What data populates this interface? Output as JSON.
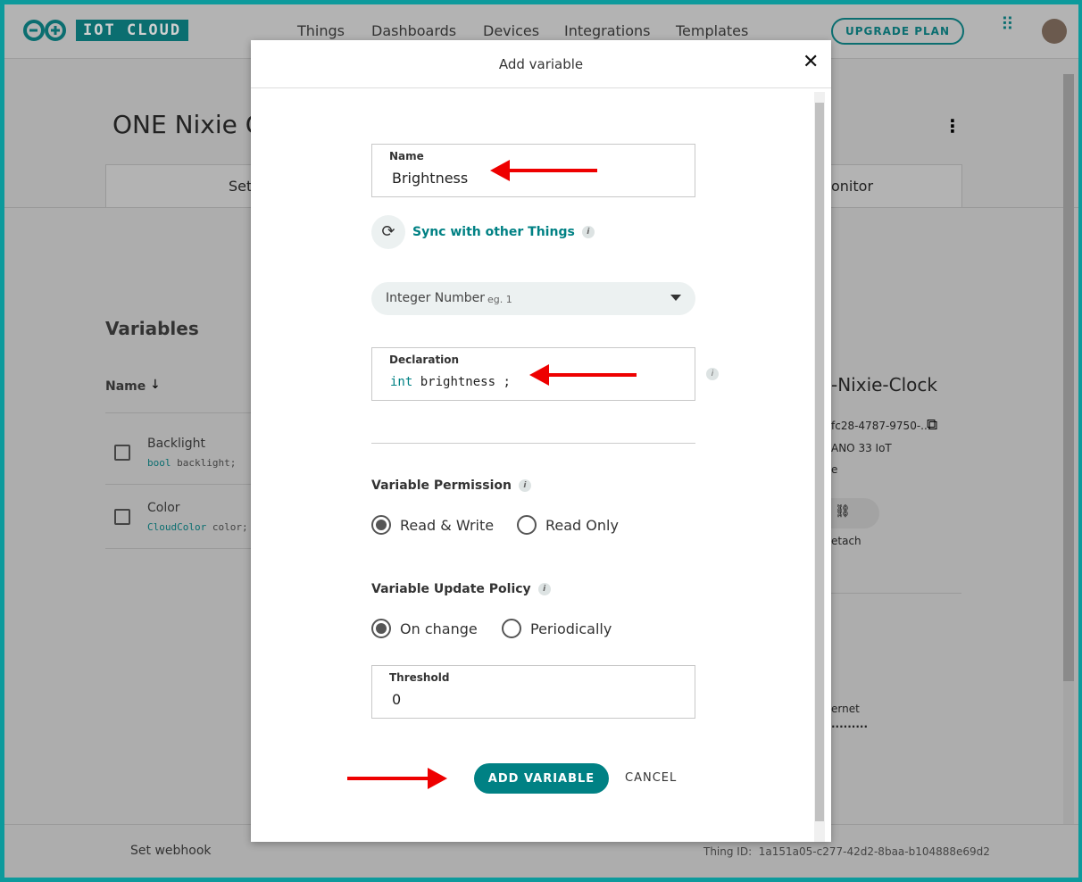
{
  "header": {
    "logo_text": "IOT CLOUD",
    "nav": [
      "Things",
      "Dashboards",
      "Devices",
      "Integrations",
      "Templates"
    ],
    "upgrade": "UPGRADE PLAN"
  },
  "background": {
    "thing_title": "ONE Nixie C",
    "tab_setup": "Set",
    "tab_monitor": "onitor",
    "variables_heading": "Variables",
    "name_col": "Name",
    "variables": [
      {
        "name": "Backlight",
        "type": "bool",
        "decl": "backlight;"
      },
      {
        "name": "Color",
        "type": "CloudColor",
        "decl": "color;"
      }
    ],
    "device_name": "-Nixie-Clock",
    "device_id": "fc28-4787-9750-...",
    "device_type": "ANO 33 IoT",
    "device_status": "e",
    "detach": "etach",
    "network": "ernet",
    "password": "·········",
    "footer_webhook": "Set webhook",
    "footer_thing_id_label": "Thing ID:",
    "footer_thing_id": "1a151a05-c277-42d2-8baa-b104888e69d2"
  },
  "modal": {
    "title": "Add variable",
    "name_label": "Name",
    "name_value": "Brightness",
    "sync_label": "Sync with other Things",
    "type_value": "Integer Number",
    "type_hint": "eg. 1",
    "declaration_label": "Declaration",
    "declaration_type": "int",
    "declaration_name": "brightness",
    "permission_label": "Variable Permission",
    "permission_options": [
      "Read & Write",
      "Read Only"
    ],
    "permission_selected": "Read & Write",
    "policy_label": "Variable Update Policy",
    "policy_options": [
      "On change",
      "Periodically"
    ],
    "policy_selected": "On change",
    "threshold_label": "Threshold",
    "threshold_value": "0",
    "add_button": "ADD VARIABLE",
    "cancel_button": "CANCEL"
  },
  "colors": {
    "accent": "#008184",
    "frame": "#0d9a9c",
    "arrow": "#e00000"
  }
}
